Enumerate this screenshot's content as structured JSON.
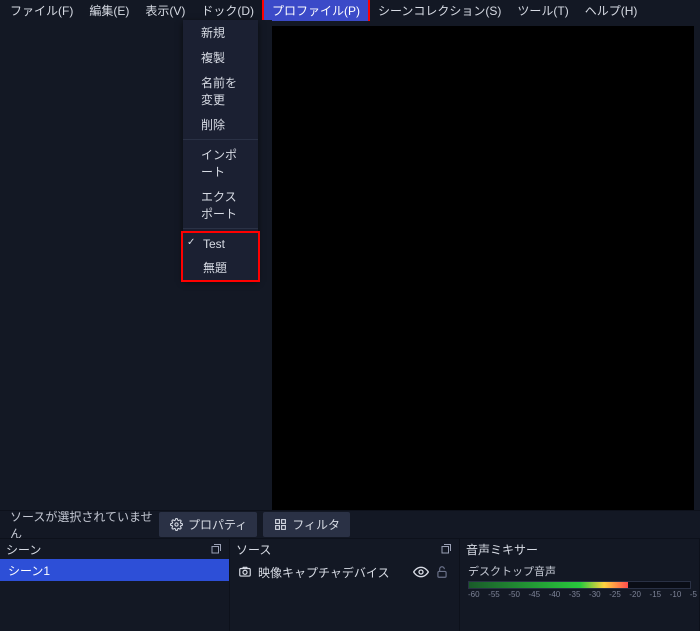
{
  "menubar": {
    "file": "ファイル(F)",
    "edit": "編集(E)",
    "view": "表示(V)",
    "dock": "ドック(D)",
    "profile": "プロファイル(P)",
    "scenecol": "シーンコレクション(S)",
    "tools": "ツール(T)",
    "help": "ヘルプ(H)"
  },
  "dropdown": {
    "new": "新規",
    "dup": "複製",
    "rename": "名前を変更",
    "delete": "削除",
    "import": "インポート",
    "export": "エクスポート",
    "p1": "Test",
    "p2": "無題"
  },
  "srcinfo": {
    "none": "ソースが選択されていません",
    "properties": "プロパティ",
    "filters": "フィルタ"
  },
  "panels": {
    "scenes": "シーン",
    "sources": "ソース",
    "mixer": "音声ミキサー"
  },
  "scenes": {
    "item1": "シーン1"
  },
  "sources": {
    "item1": "映像キャプチャデバイス"
  },
  "mixer": {
    "track1": "デスクトップ音声",
    "ticks": {
      "t0": "-60",
      "t1": "-55",
      "t2": "-50",
      "t3": "-45",
      "t4": "-40",
      "t5": "-35",
      "t6": "-30",
      "t7": "-25",
      "t8": "-20",
      "t9": "-15",
      "t10": "-10",
      "t11": "-5"
    }
  }
}
